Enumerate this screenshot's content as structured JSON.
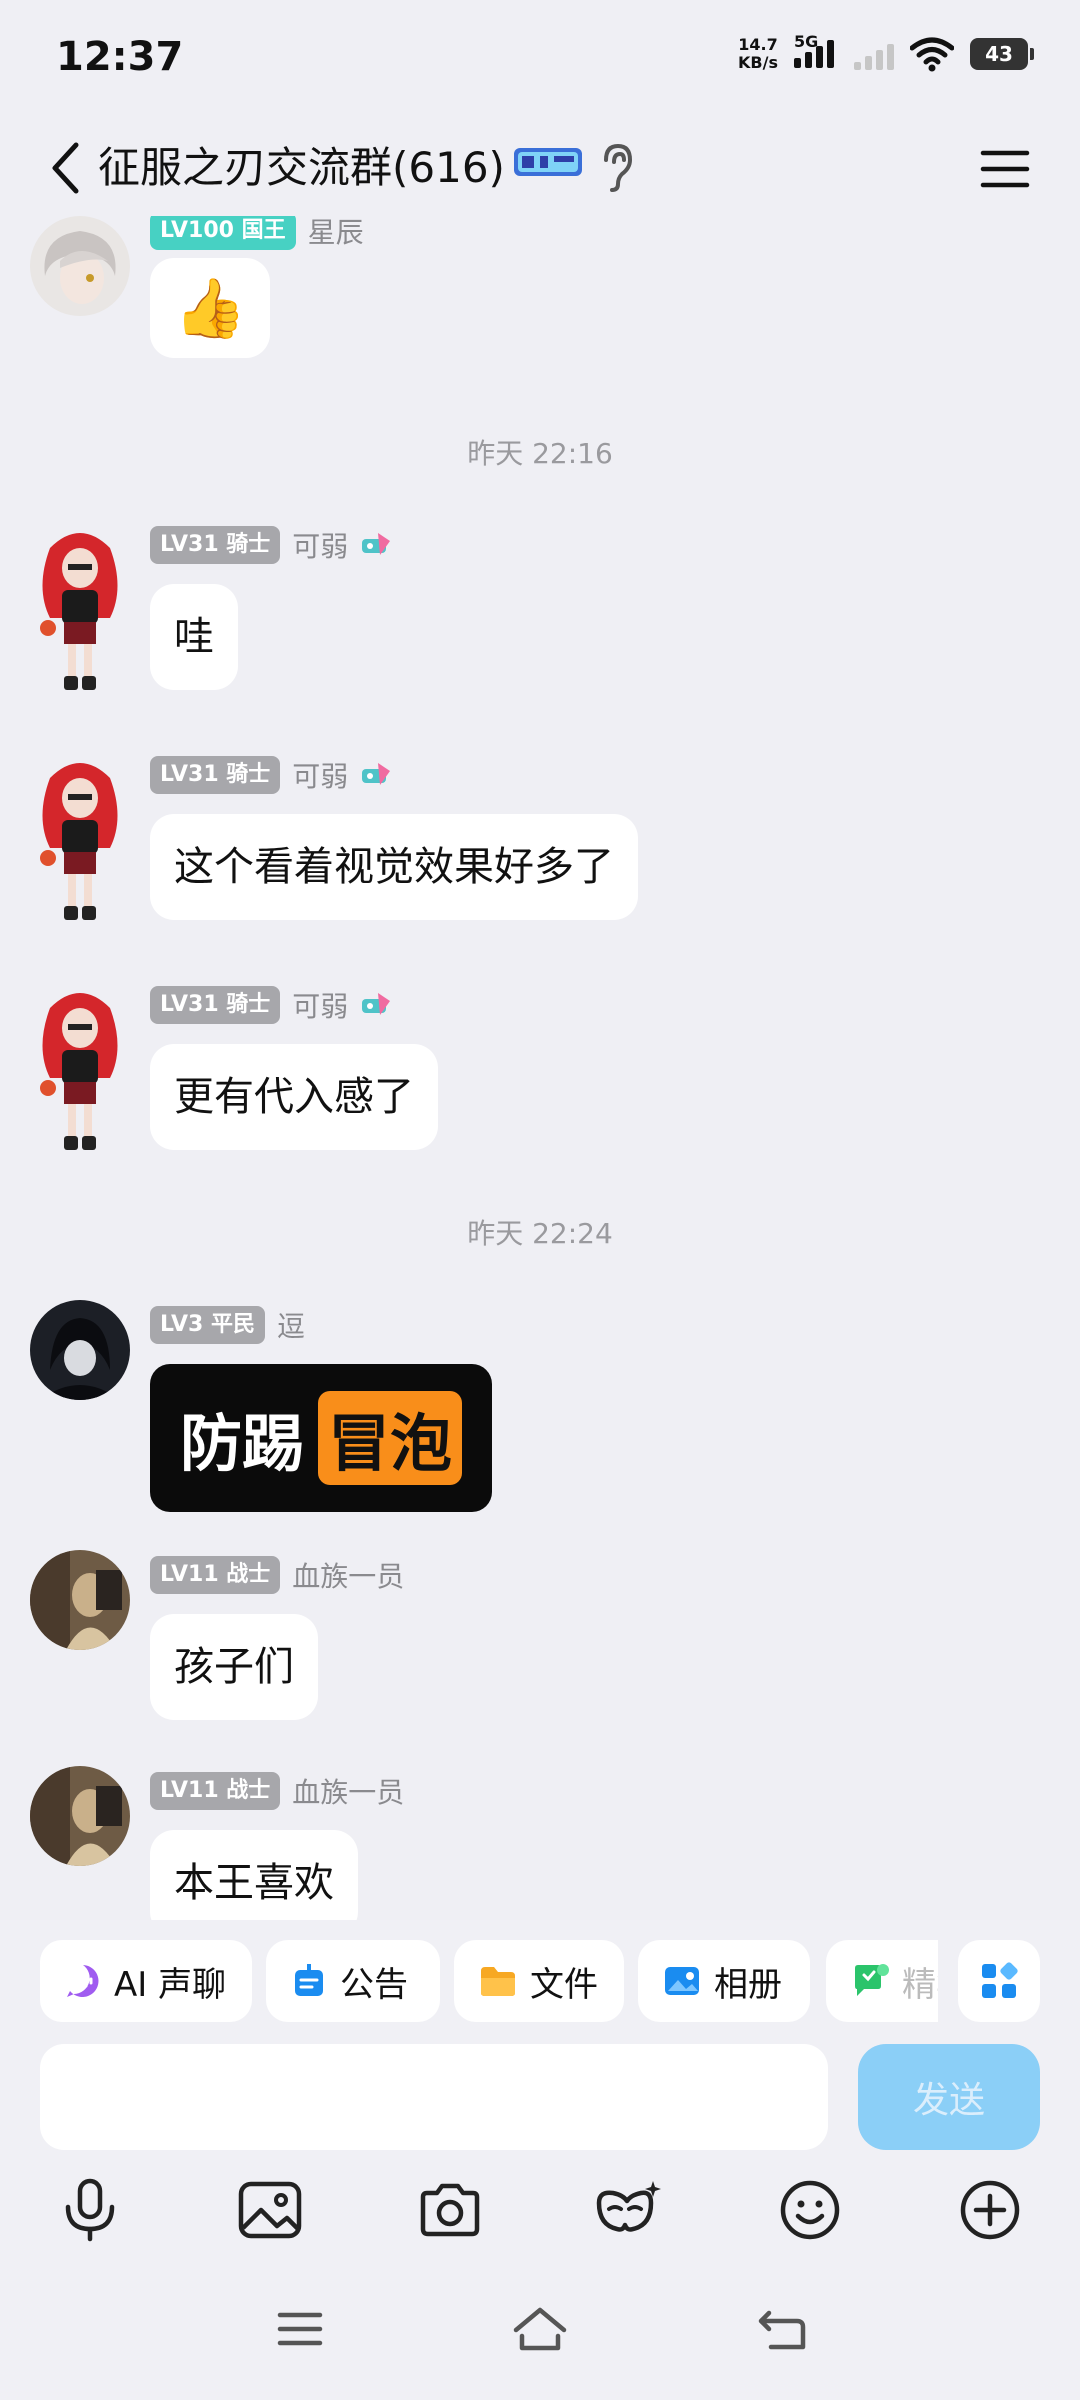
{
  "status_bar": {
    "time": "12:37",
    "net_speed_value": "14.7",
    "net_speed_unit": "KB/s",
    "network": "5G",
    "battery": "43"
  },
  "header": {
    "title": "征服之刃交流群(616)"
  },
  "messages": [
    {
      "level": "LV100 国王",
      "nick": "星辰",
      "content_emoji": "👍"
    },
    {
      "timestamp": "昨天 22:16"
    },
    {
      "level": "LV31 骑士",
      "nick": "可弱",
      "text": "哇"
    },
    {
      "level": "LV31 骑士",
      "nick": "可弱",
      "text": "这个看着视觉效果好多了"
    },
    {
      "level": "LV31 骑士",
      "nick": "可弱",
      "text": "更有代入感了"
    },
    {
      "timestamp": "昨天 22:24"
    },
    {
      "level": "LV3 平民",
      "nick": "逗",
      "sticker_left": "防踢",
      "sticker_right": "冒泡"
    },
    {
      "level": "LV11 战士",
      "nick": "血族一员",
      "text": "孩子们"
    },
    {
      "level": "LV11 战士",
      "nick": "血族一员",
      "text": "本王喜欢"
    }
  ],
  "toolbar": {
    "ai": "AI 声聊",
    "notice": "公告",
    "files": "文件",
    "album": "相册",
    "essence": "精华"
  },
  "input": {
    "send": "发送"
  },
  "colors": {
    "accent": "#12b7f5",
    "send_disabled": "#8bcff7",
    "level_gray": "#a7a7ab",
    "level_teal": "#47d1c3"
  }
}
